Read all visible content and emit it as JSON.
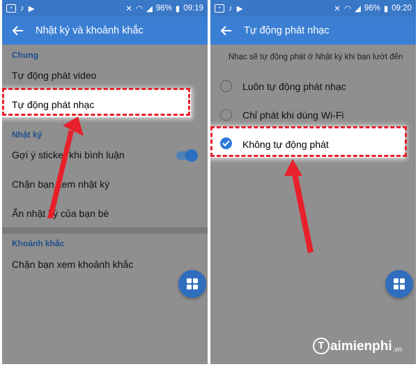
{
  "left": {
    "status": {
      "battery": "96%",
      "time": "09:19"
    },
    "title": "Nhật ký và khoảnh khắc",
    "section_general": "Chung",
    "item_autoplay_video": "Tự động phát video",
    "item_autoplay_music": "Tự động phát nhạc",
    "section_diary": "Nhật ký",
    "item_sticker": "Gợi ý sticker khi bình luận",
    "item_sticker_on": true,
    "item_block_diary": "Chặn bạn xem nhật ký",
    "item_hide_diary": "Ẩn nhật ký của bạn bè",
    "section_moment": "Khoảnh khắc",
    "item_block_moment": "Chặn bạn xem khoảnh khắc"
  },
  "right": {
    "status": {
      "battery": "96%",
      "time": "09:20"
    },
    "title": "Tự động phát nhạc",
    "description": "Nhạc sẽ tự động phát ở Nhật ký khi bạn lướt đến",
    "options": [
      {
        "label": "Luôn tự động phát nhạc",
        "selected": false
      },
      {
        "label": "Chỉ phát khi dùng Wi-Fi",
        "selected": false
      },
      {
        "label": "Không tự động phát",
        "selected": true
      }
    ]
  },
  "watermark": {
    "logo_letter": "T",
    "brand": "aimienphi",
    "tld": ".vn"
  },
  "colors": {
    "status_bar": "#3977c7",
    "app_bar": "#3b7fd4",
    "highlight_border": "#e8202a",
    "arrow": "#e8202a",
    "accent": "#2d7bd8"
  },
  "icons": [
    "back-arrow-icon",
    "wifi-icon",
    "signal-icon",
    "battery-icon",
    "grid-icon",
    "check-icon"
  ]
}
